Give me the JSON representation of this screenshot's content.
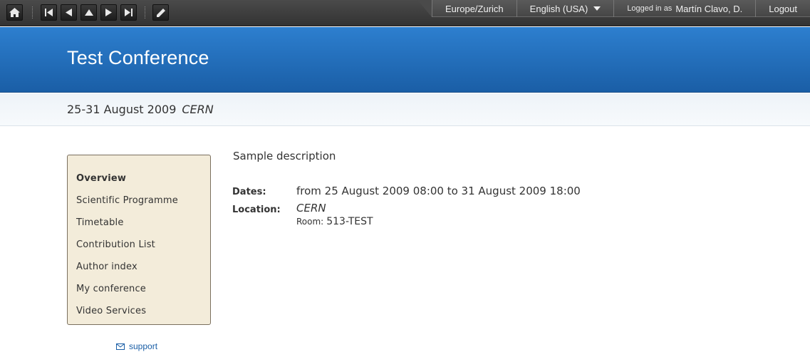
{
  "toolbar": {
    "buttons": [
      {
        "name": "home-button",
        "icon": "home-icon"
      },
      {
        "name": "first-event-button",
        "icon": "skip-first-icon"
      },
      {
        "name": "previous-event-button",
        "icon": "arrow-left-icon"
      },
      {
        "name": "up-category-button",
        "icon": "arrow-up-icon"
      },
      {
        "name": "next-event-button",
        "icon": "arrow-right-icon"
      },
      {
        "name": "last-event-button",
        "icon": "skip-last-icon"
      },
      {
        "name": "edit-event-button",
        "icon": "pencil-icon"
      }
    ],
    "timezone": "Europe/Zurich",
    "language": "English (USA)",
    "logged_in_prefix": "Logged in as",
    "user_name": "Martín Clavo, D.",
    "logout_label": "Logout"
  },
  "header": {
    "title": "Test Conference"
  },
  "date_band": {
    "dates": "25-31 August 2009",
    "place": "CERN"
  },
  "sidebar": {
    "items": [
      {
        "label": "Overview",
        "active": true
      },
      {
        "label": "Scientific Programme",
        "active": false
      },
      {
        "label": "Timetable",
        "active": false
      },
      {
        "label": "Contribution List",
        "active": false
      },
      {
        "label": "Author index",
        "active": false
      },
      {
        "label": "My conference",
        "active": false
      },
      {
        "label": "Video Services",
        "active": false
      }
    ],
    "support_label": "support",
    "support_icon": "envelope-icon"
  },
  "main": {
    "description": "Sample description",
    "dates_label": "Dates:",
    "dates_value": "from 25 August 2009 08:00 to 31 August 2009 18:00",
    "location_label": "Location:",
    "location_value": "CERN",
    "room_label": "Room:",
    "room_value": "513-TEST"
  },
  "colors": {
    "header_blue": "#1a5ea6",
    "menu_bg": "#f3ecda",
    "toolbar_dark": "#333333",
    "link_blue": "#1a5ea6"
  }
}
